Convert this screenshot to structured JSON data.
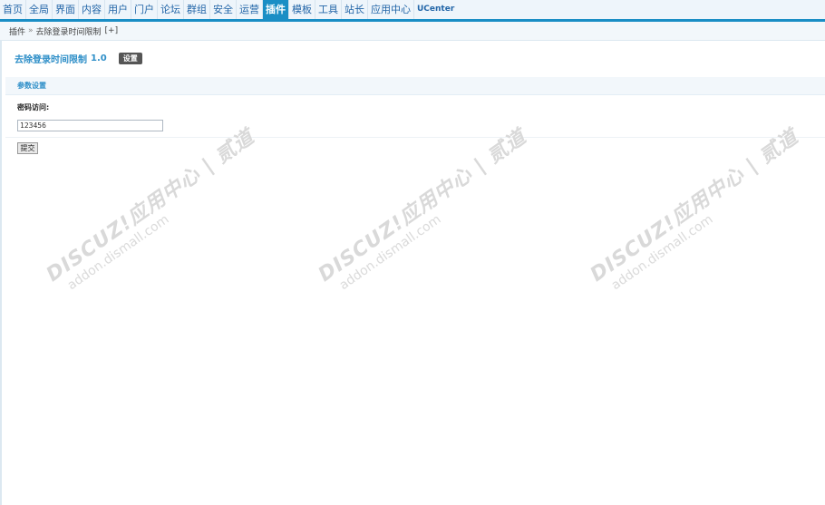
{
  "nav": {
    "items": [
      "首页",
      "全局",
      "界面",
      "内容",
      "用户",
      "门户",
      "论坛",
      "群组",
      "安全",
      "运营",
      "插件",
      "模板",
      "工具",
      "站长",
      "应用中心",
      "UCenter"
    ],
    "active_index": 10
  },
  "breadcrumb": {
    "section": "插件",
    "separator": "»",
    "page": "去除登录时间限制",
    "toggle": "[+]"
  },
  "plugin": {
    "name": "去除登录时间限制",
    "version": "1.0",
    "tab_label": "设置"
  },
  "form": {
    "section_title": "参数设置",
    "field_label": "密码访问:",
    "field_value": "123456",
    "submit_label": "提交"
  },
  "watermark": {
    "brand": "DISCUZ!应用中心 | 贰道",
    "domain": "addon.dismall.com"
  },
  "colors": {
    "accent": "#1a8ec5",
    "title": "#2f8fc8"
  }
}
